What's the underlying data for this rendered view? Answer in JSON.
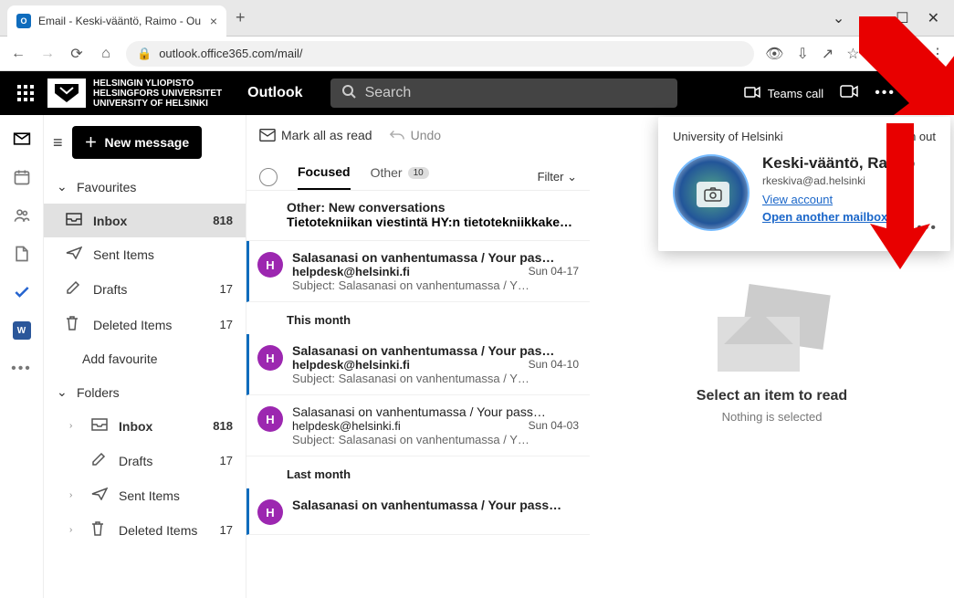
{
  "browser": {
    "tab_title": "Email - Keski-vääntö, Raimo - Ou",
    "url": "outlook.office365.com/mail/"
  },
  "suite": {
    "uni_line1": "HELSINGIN YLIOPISTO",
    "uni_line2": "HELSINGFORS UNIVERSITET",
    "uni_line3": "UNIVERSITY OF HELSINKI",
    "app": "Outlook",
    "search_placeholder": "Search",
    "teams_call": "Teams call"
  },
  "folders": {
    "new_message": "New message",
    "favourites": "Favourites",
    "fav_items": [
      {
        "icon": "inbox",
        "label": "Inbox",
        "count": "818",
        "selected": true
      },
      {
        "icon": "sent",
        "label": "Sent Items",
        "count": ""
      },
      {
        "icon": "draft",
        "label": "Drafts",
        "count": "17"
      },
      {
        "icon": "trash",
        "label": "Deleted Items",
        "count": "17"
      }
    ],
    "add_fav": "Add favourite",
    "folders_label": "Folders",
    "folder_items": [
      {
        "icon": "inbox",
        "label": "Inbox",
        "count": "818",
        "expandable": true
      },
      {
        "icon": "draft",
        "label": "Drafts",
        "count": "17"
      },
      {
        "icon": "sent",
        "label": "Sent Items",
        "count": "",
        "expandable": true
      },
      {
        "icon": "trash",
        "label": "Deleted Items",
        "count": "17",
        "expandable": true
      }
    ]
  },
  "toolbar": {
    "mark_read": "Mark all as read",
    "undo": "Undo"
  },
  "tabs": {
    "focused": "Focused",
    "other": "Other",
    "other_count": "10",
    "filter": "Filter"
  },
  "other_banner": {
    "title": "Other: New conversations",
    "subtitle": "Tietotekniikan viestintä HY:n tietotekniikkake…"
  },
  "groups": {
    "this_month": "This month",
    "last_month": "Last month"
  },
  "messages": [
    {
      "unread": true,
      "avatar": "H",
      "subject": "Salasanasi on vanhentumassa / Your pas…",
      "from": "helpdesk@helsinki.fi",
      "date": "Sun 04-17",
      "preview": "Subject: Salasanasi on vanhentumassa / Y…"
    },
    {
      "unread": true,
      "avatar": "H",
      "subject": "Salasanasi on vanhentumassa / Your pas…",
      "from": "helpdesk@helsinki.fi",
      "date": "Sun 04-10",
      "preview": "Subject: Salasanasi on vanhentumassa / Y…"
    },
    {
      "unread": false,
      "avatar": "H",
      "subject": "Salasanasi on vanhentumassa / Your pass…",
      "from": "helpdesk@helsinki.fi",
      "date": "Sun 04-03",
      "preview": "Subject: Salasanasi on vanhentumassa / Y…"
    },
    {
      "unread": true,
      "avatar": "H",
      "subject": "Salasanasi on vanhentumassa / Your pass…",
      "from": "helpdesk@helsinki.fi",
      "date": "",
      "preview": ""
    }
  ],
  "reading": {
    "title": "Select an item to read",
    "subtitle": "Nothing is selected"
  },
  "flyout": {
    "org": "University of Helsinki",
    "signout": "Sign out",
    "name": "Keski-vääntö, Raimo",
    "email": "rkeskiva@ad.helsinki",
    "view_account": "View account",
    "open_mailbox": "Open another mailbox"
  }
}
